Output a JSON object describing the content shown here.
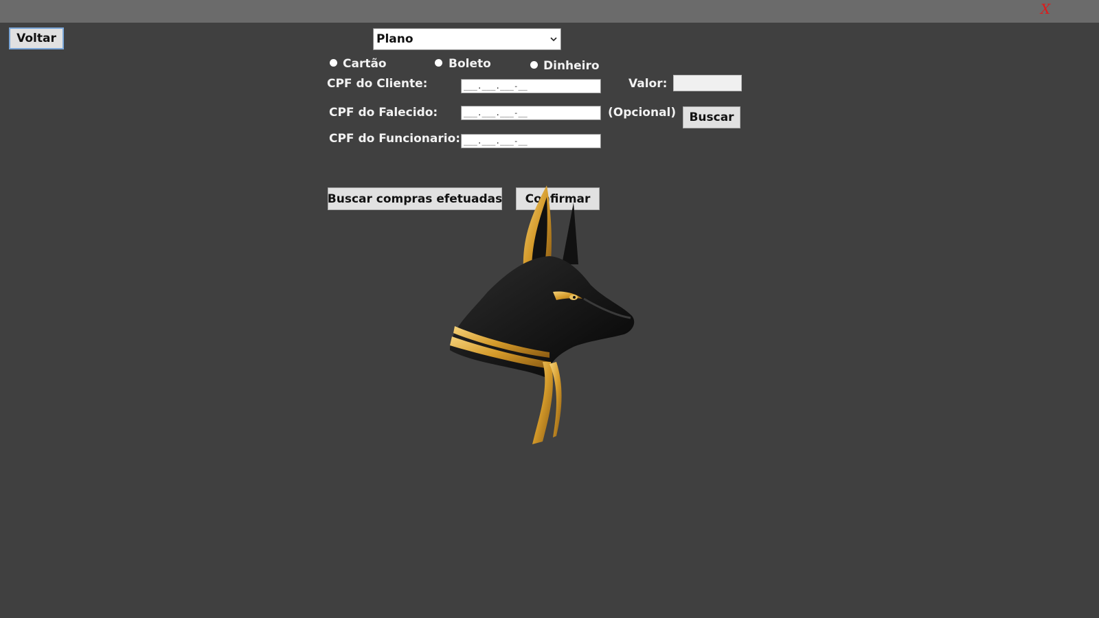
{
  "window": {
    "close_label": "X"
  },
  "toolbar": {
    "back_label": "Voltar"
  },
  "plan_select": {
    "selected": "Plano"
  },
  "payment": {
    "options": [
      {
        "label": "Cartão"
      },
      {
        "label": "Boleto"
      },
      {
        "label": "Dinheiro"
      }
    ]
  },
  "form": {
    "cliente_label": "CPF do Cliente:",
    "falecido_label": "CPF do Falecido:",
    "funcionario_label": "CPF do Funcionario:",
    "cpf_mask": "___.___.___-__",
    "valor_label": "Valor:",
    "valor_value": "",
    "opcional_label": "(Opcional)",
    "buscar_label": "Buscar"
  },
  "actions": {
    "buscar_compras_label": "Buscar compras efetuadas",
    "confirmar_label": "Confirmar"
  }
}
